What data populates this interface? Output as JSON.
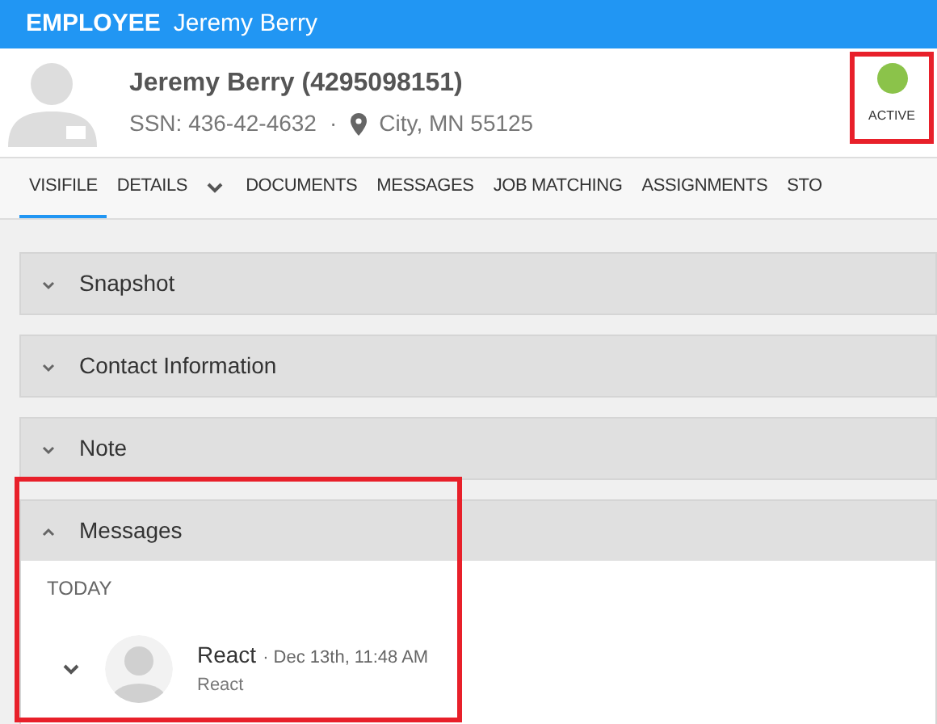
{
  "header": {
    "label": "EMPLOYEE",
    "name": "Jeremy Berry"
  },
  "profile": {
    "name": "Jeremy Berry (4295098151)",
    "ssn": "SSN: 436-42-4632",
    "separator": "·",
    "location": "City, MN 55125",
    "status": {
      "label": "ACTIVE",
      "color": "#8bc34a"
    }
  },
  "tabs": [
    {
      "label": "VISIFILE",
      "selected": true,
      "dropdown": false
    },
    {
      "label": "DETAILS",
      "selected": false,
      "dropdown": true
    },
    {
      "label": "DOCUMENTS",
      "selected": false,
      "dropdown": false
    },
    {
      "label": "MESSAGES",
      "selected": false,
      "dropdown": false
    },
    {
      "label": "JOB MATCHING",
      "selected": false,
      "dropdown": false
    },
    {
      "label": "ASSIGNMENTS",
      "selected": false,
      "dropdown": false
    },
    {
      "label": "STO",
      "selected": false,
      "dropdown": false
    }
  ],
  "sections": [
    {
      "title": "Snapshot",
      "expanded": false
    },
    {
      "title": "Contact Information",
      "expanded": false
    },
    {
      "title": "Note",
      "expanded": false
    },
    {
      "title": "Messages",
      "expanded": true,
      "group": "TODAY",
      "messages": [
        {
          "author": "React",
          "time": "· Dec 13th, 11:48 AM",
          "body": "React",
          "expanded": false
        }
      ]
    }
  ]
}
